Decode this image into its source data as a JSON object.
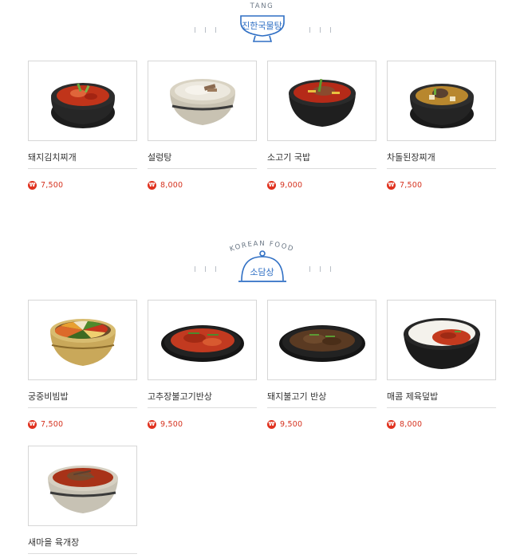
{
  "sections": [
    {
      "subtitle": "TANG",
      "title": "진한국물탕",
      "items": [
        {
          "name": "돼지김치찌개",
          "price": "7,500",
          "food_icon": "kimchi-stew-icon"
        },
        {
          "name": "설렁탕",
          "price": "8,000",
          "food_icon": "seolleongtang-icon"
        },
        {
          "name": "소고기 국밥",
          "price": "9,000",
          "food_icon": "beef-gukbap-icon"
        },
        {
          "name": "차돌된장찌개",
          "price": "7,500",
          "food_icon": "doenjang-stew-icon"
        }
      ]
    },
    {
      "subtitle": "KOREAN FOOD",
      "title": "소담상",
      "items": [
        {
          "name": "궁중비빔밥",
          "price": "7,500",
          "food_icon": "bibimbap-icon"
        },
        {
          "name": "고추장불고기반상",
          "price": "9,500",
          "food_icon": "gochujang-bulgogi-icon"
        },
        {
          "name": "돼지불고기 반상",
          "price": "9,500",
          "food_icon": "pork-bulgogi-icon"
        },
        {
          "name": "매콤 제육덮밥",
          "price": "8,000",
          "food_icon": "jeyuk-rice-icon"
        },
        {
          "name": "새마을 육개장",
          "price": "",
          "food_icon": "yukgaejang-icon"
        }
      ]
    }
  ],
  "currency_symbol": "₩",
  "colors": {
    "accent_blue": "#2f6fc4",
    "price_red": "#d5321f",
    "border_gray": "#d6d6d6"
  }
}
